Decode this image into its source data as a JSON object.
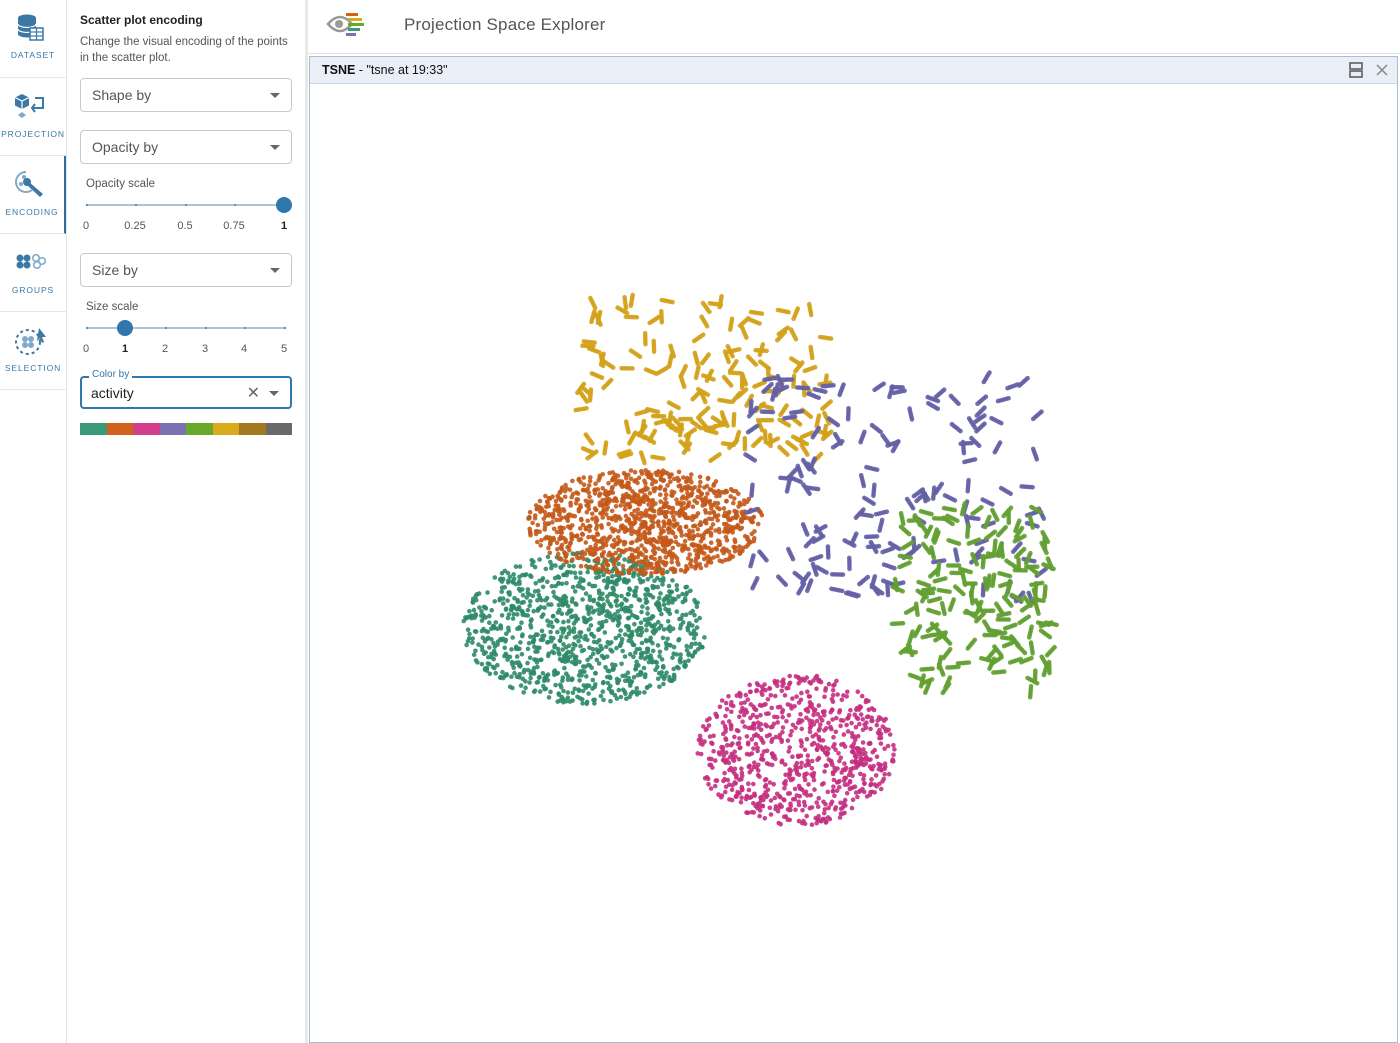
{
  "rail": {
    "items": [
      {
        "label": "DATASET",
        "icon": "database-icon"
      },
      {
        "label": "PROJECTION",
        "icon": "projection-icon"
      },
      {
        "label": "ENCODING",
        "icon": "encoding-brush-icon"
      },
      {
        "label": "GROUPS",
        "icon": "groups-icon"
      },
      {
        "label": "SELECTION",
        "icon": "selection-lasso-icon"
      }
    ],
    "active": "ENCODING"
  },
  "panel": {
    "title": "Scatter plot encoding",
    "description": "Change the visual encoding of the points in the scatter plot.",
    "shape_by": "Shape by",
    "opacity_by": "Opacity by",
    "opacity_scale": {
      "label": "Opacity scale",
      "marks": [
        "0",
        "0.25",
        "0.5",
        "0.75",
        "1"
      ],
      "value": 1
    },
    "size_by": "Size by",
    "size_scale": {
      "label": "Size scale",
      "marks": [
        "0",
        "1",
        "2",
        "3",
        "4",
        "5"
      ],
      "value": 1
    },
    "color_by": {
      "label": "Color by",
      "value": "activity"
    },
    "palette": [
      "#3a9a78",
      "#d1621c",
      "#d43d8c",
      "#7b70b2",
      "#69a82a",
      "#dba91c",
      "#a37920",
      "#6a6a6a"
    ]
  },
  "header": {
    "title": "Projection Space Explorer"
  },
  "view": {
    "title_prefix": "TSNE",
    "title_rest": " - \"tsne at 19:33\""
  },
  "chart_data": {
    "type": "scatter",
    "clusters": [
      {
        "color": "#2d8a67",
        "center": [
          -0.56,
          -0.1
        ],
        "spread": [
          0.37,
          0.23
        ],
        "count": 1100
      },
      {
        "color": "#c4591a",
        "center": [
          -0.38,
          0.22
        ],
        "spread": [
          0.36,
          0.16
        ],
        "count": 1100
      },
      {
        "color": "#c42f7f",
        "center": [
          0.08,
          -0.47
        ],
        "spread": [
          0.3,
          0.23
        ],
        "count": 800
      },
      {
        "color": "#d3a21c",
        "center": [
          -0.2,
          0.65
        ],
        "spread": [
          0.38,
          0.24
        ],
        "count": 160
      },
      {
        "color": "#6560a6",
        "center": [
          0.38,
          0.32
        ],
        "spread": [
          0.45,
          0.34
        ],
        "count": 150
      },
      {
        "color": "#63a032",
        "center": [
          0.62,
          -0.02
        ],
        "spread": [
          0.24,
          0.28
        ],
        "count": 160
      }
    ]
  }
}
